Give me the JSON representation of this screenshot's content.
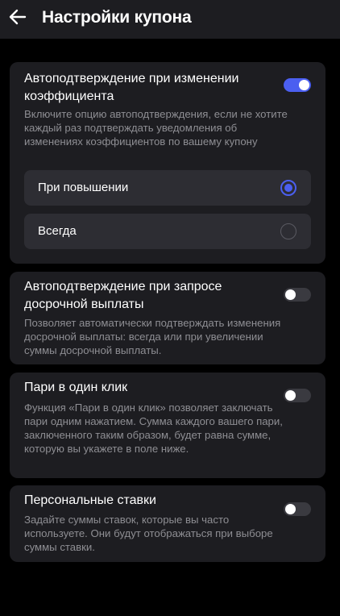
{
  "header": {
    "back_icon": "arrow-left-icon",
    "title": "Настройки купона"
  },
  "colors": {
    "background": "#000000",
    "card": "#1d1d21",
    "option": "#2d2d33",
    "accent": "#4b5ff0",
    "secondary_text": "#8e8e93"
  },
  "settings": [
    {
      "title": "Автоподтверждение при изменении коэффициента",
      "description": "Включите опцию автоподтверждения, если не хотите каждый раз подтверждать уведомления об изменениях коэффициентов по вашему купону",
      "enabled": true,
      "options": [
        {
          "label": "При повышении",
          "selected": true
        },
        {
          "label": "Всегда",
          "selected": false
        }
      ]
    },
    {
      "title": "Автоподтверждение при запросе досрочной выплаты",
      "description": "Позволяет автоматически подтверждать изменения досрочной выплаты: всегда или при увеличении суммы досрочной выплаты.",
      "enabled": false
    },
    {
      "title": "Пари в один клик",
      "description": "Функция «Пари в один клик» позволяет заключать пари одним нажатием. Сумма каждого вашего пари, заключенного таким образом, будет равна сумме, которую вы укажете в поле ниже.",
      "enabled": false
    },
    {
      "title": "Персональные ставки",
      "description": "Задайте суммы ставок, которые вы часто используете. Они будут отображаться при выборе суммы ставки.",
      "enabled": false
    }
  ]
}
